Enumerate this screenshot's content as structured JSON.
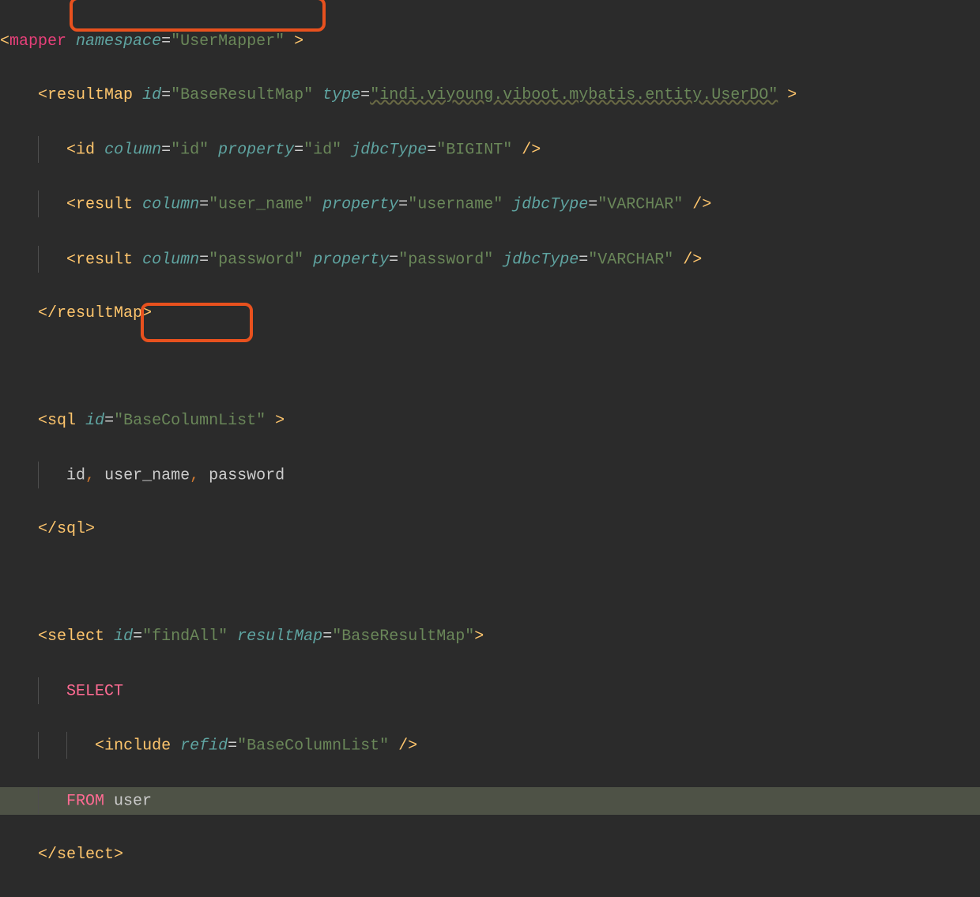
{
  "l1": {
    "open": "<",
    "tag": "mapper",
    "sp": " ",
    "attr": "namespace",
    "eq": "=",
    "val": "\"UserMapper\"",
    "end": " >"
  },
  "l2": {
    "pad": "    ",
    "open": "<",
    "tag": "resultMap",
    "sp": " ",
    "attr1": "id",
    "eq1": "=",
    "val1": "\"BaseResultMap\"",
    "sp2": " ",
    "attr2": "type",
    "eq2": "=",
    "val2": "\"indi.viyoung.viboot.mybatis.entity.UserDO\"",
    "end": " >"
  },
  "l3": {
    "open": "<",
    "tag": "id",
    "attr1": "column",
    "val1": "\"id\"",
    "attr2": "property",
    "val2": "\"id\"",
    "attr3": "jdbcType",
    "val3": "\"BIGINT\"",
    "end": " />"
  },
  "l4": {
    "open": "<",
    "tag": "result",
    "attr1": "column",
    "val1": "\"user_name\"",
    "attr2": "property",
    "val2": "\"username\"",
    "attr3": "jdbcType",
    "val3": "\"VARCHAR\"",
    "end": " />"
  },
  "l5": {
    "open": "<",
    "tag": "result",
    "attr1": "column",
    "val1": "\"password\"",
    "attr2": "property",
    "val2": "\"password\"",
    "attr3": "jdbcType",
    "val3": "\"VARCHAR\"",
    "end": " />"
  },
  "l6": {
    "open": "</",
    "tag": "resultMap",
    "end": ">"
  },
  "l8": {
    "open": "<",
    "tag": "sql",
    "attr1": "id",
    "val1": "\"BaseColumnList\"",
    "end": " >"
  },
  "l9": {
    "txt1": "id",
    "c1": ",",
    "txt2": " user_name",
    "c2": ",",
    "txt3": " password"
  },
  "l10": {
    "open": "</",
    "tag": "sql",
    "end": ">"
  },
  "l12": {
    "open": "<",
    "tag": "select",
    "attr1": "id",
    "val1a": "\"",
    "val1b": "findAll",
    "val1c": "\"",
    "attr2": "resultMap",
    "val2": "\"BaseResultMap\"",
    "end": ">"
  },
  "l13": {
    "kw": "SELECT"
  },
  "l14": {
    "open": "<",
    "tag": "include",
    "attr1": "refid",
    "val1": "\"BaseColumnList\"",
    "end": " />"
  },
  "l15": {
    "kw1": "FROM",
    "txt": " user"
  },
  "l16": {
    "open": "</",
    "tag": "select",
    "end": ">"
  }
}
